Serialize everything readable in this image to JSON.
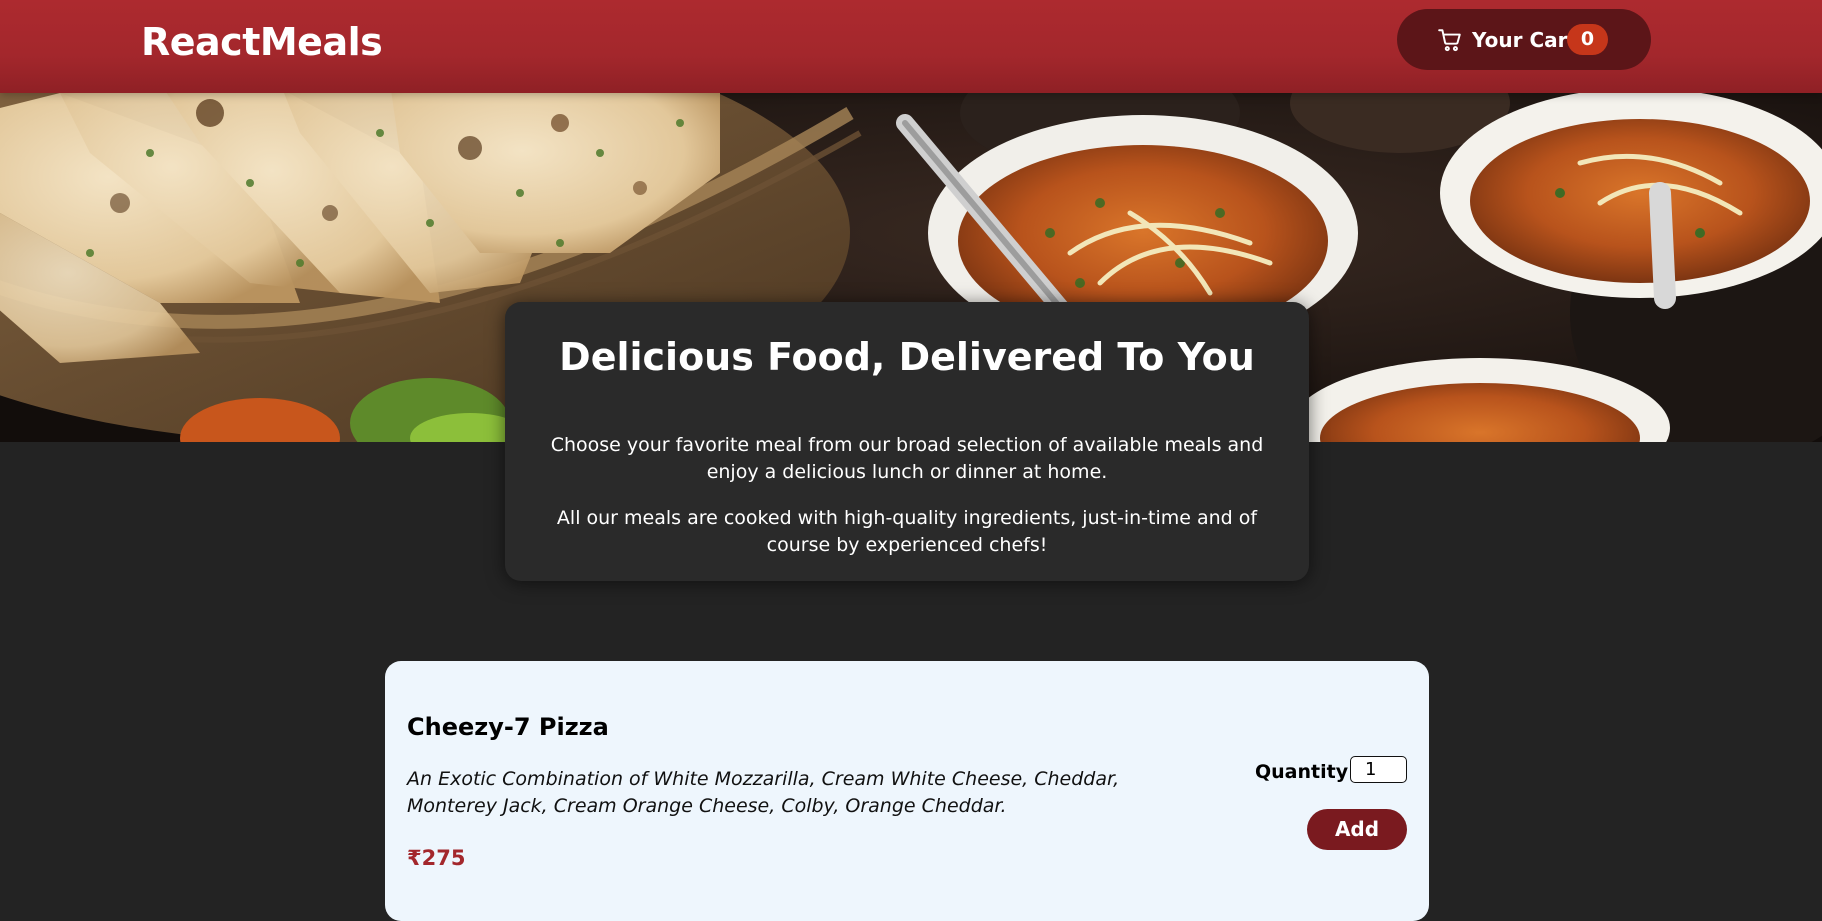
{
  "header": {
    "brand": "ReactMeals",
    "cart": {
      "label": "Your Cart",
      "count": "0",
      "icon": "cart-icon"
    }
  },
  "hero": {
    "image": "indian-meals-naan-curry-photo"
  },
  "summary": {
    "title": "Delicious Food, Delivered To You",
    "paragraph_1": "Choose your favorite meal from our broad selection of available meals and enjoy a delicious lunch or dinner at home.",
    "paragraph_2": "All our meals are cooked with high-quality ingredients, just-in-time and of course by experienced chefs!"
  },
  "meals": [
    {
      "name": "Cheezy-7 Pizza",
      "description": "An Exotic Combination of White Mozzarilla, Cream White Cheese, Cheddar, Monterey Jack, Cream Orange Cheese, Colby, Orange Cheddar.",
      "price": "₹275",
      "quantity_label": "Quantity",
      "quantity_value": "1",
      "add_label": "Add"
    }
  ],
  "colors": {
    "header": "#a3272c",
    "cart_button": "#5c1518",
    "badge": "#c6361a",
    "page_bg": "#232323",
    "card_bg": "#eef6fd",
    "price": "#a3272c",
    "add_button": "#7a1a1f"
  }
}
